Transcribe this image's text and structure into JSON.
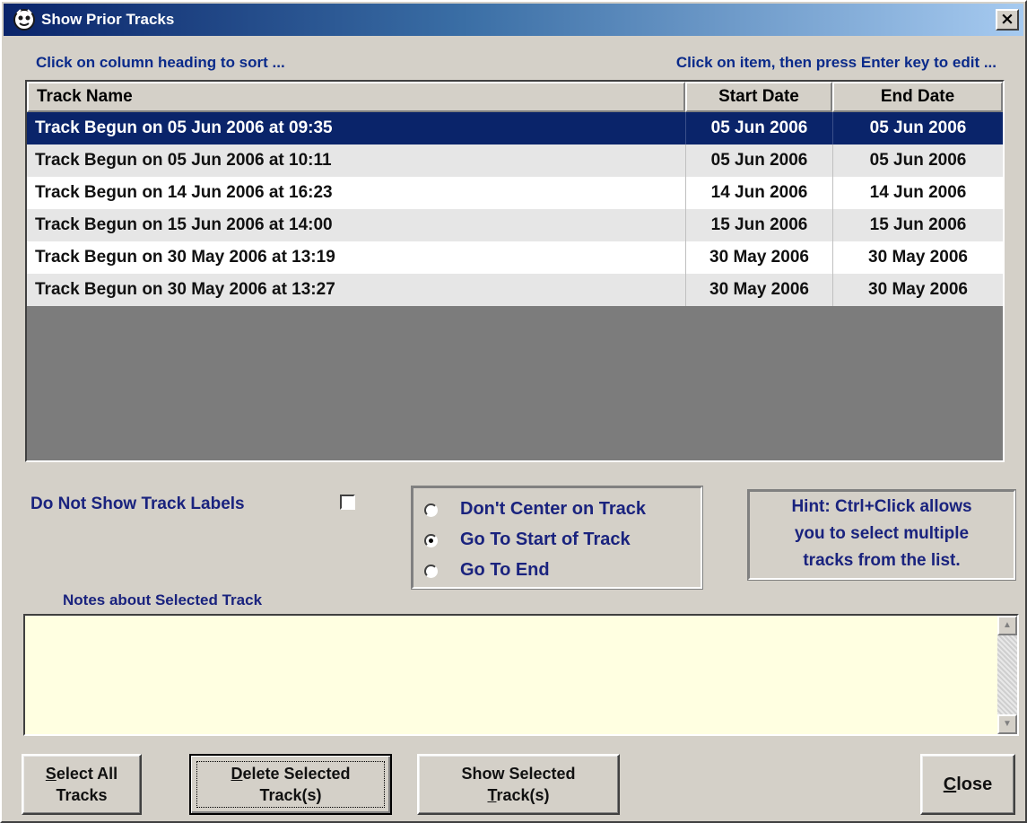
{
  "window": {
    "title": "Show Prior Tracks",
    "close_label": "×",
    "hint_sort": "Click on column heading to sort ...",
    "hint_edit": "Click on item,  then press Enter key to edit ..."
  },
  "table": {
    "columns": [
      "Track Name",
      "Start Date",
      "End Date"
    ],
    "rows": [
      {
        "name": "Track Begun on 05 Jun 2006 at 09:35",
        "start": "05 Jun 2006",
        "end": "05 Jun 2006",
        "selected": true
      },
      {
        "name": "Track Begun on 05 Jun 2006 at 10:11",
        "start": "05 Jun 2006",
        "end": "05 Jun 2006",
        "selected": false
      },
      {
        "name": "Track Begun on 14 Jun 2006 at 16:23",
        "start": "14 Jun 2006",
        "end": "14 Jun 2006",
        "selected": false
      },
      {
        "name": "Track Begun on 15 Jun 2006 at 14:00",
        "start": "15 Jun 2006",
        "end": "15 Jun 2006",
        "selected": false
      },
      {
        "name": "Track Begun on 30 May 2006 at 13:19",
        "start": "30 May 2006",
        "end": "30 May 2006",
        "selected": false
      },
      {
        "name": "Track Begun on 30 May 2006 at 13:27",
        "start": "30 May 2006",
        "end": "30 May 2006",
        "selected": false
      }
    ]
  },
  "options": {
    "no_labels_label": "Do Not Show Track Labels",
    "no_labels_checked": false,
    "radios": [
      {
        "label": "Don't Center on Track",
        "checked": false
      },
      {
        "label": "Go To Start of Track",
        "checked": true
      },
      {
        "label": "Go To End",
        "checked": false
      }
    ],
    "hint_lines": [
      "Hint:  Ctrl+Click allows",
      "you to select multiple",
      "tracks from the list."
    ]
  },
  "notes": {
    "label": "Notes about Selected Track",
    "value": ""
  },
  "buttons": {
    "select_all": [
      "Select All",
      "Tracks"
    ],
    "delete": [
      "Delete Selected",
      "Track(s)"
    ],
    "show": [
      "Show Selected",
      "Track(s)"
    ],
    "close": "Close"
  },
  "colors": {
    "face": "#d4d0c8",
    "selection": "#0a246a",
    "label_blue": "#1a237e",
    "notes_bg": "#ffffe1"
  }
}
